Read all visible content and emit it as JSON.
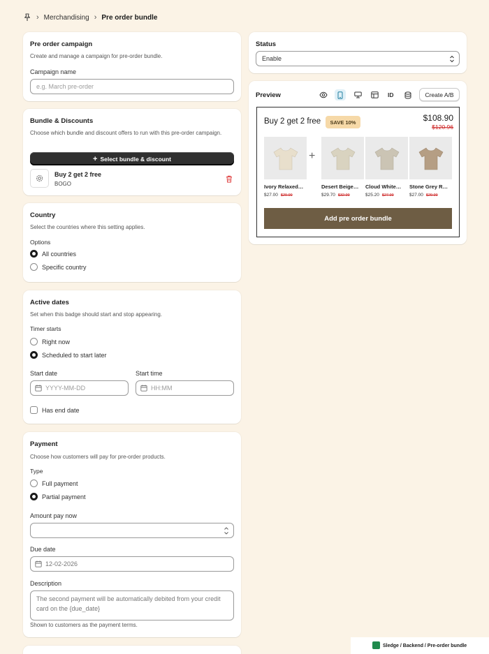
{
  "breadcrumb": {
    "parent": "Merchandising",
    "current": "Pre order bundle"
  },
  "campaign": {
    "title": "Pre order campaign",
    "description": "Create and manage a campaign for pre-order bundle.",
    "name_label": "Campaign name",
    "name_placeholder": "e.g. March pre-order"
  },
  "bundle": {
    "title": "Bundle & Discounts",
    "description": "Choose which bundle and discount offers to run with this pre-order campaign.",
    "select_button": "Select bundle & discount",
    "item_title": "Buy 2 get 2 free",
    "item_subtitle": "BOGO"
  },
  "country": {
    "title": "Country",
    "description": "Select the countries where this setting applies.",
    "options_label": "Options",
    "options": [
      "All countries",
      "Specific country"
    ],
    "selected": "All countries"
  },
  "dates": {
    "title": "Active dates",
    "description": "Set when this badge should start and stop appearing.",
    "timer_label": "Timer starts",
    "timer_options": [
      "Right now",
      "Scheduled to start later"
    ],
    "selected": "Scheduled to start later",
    "start_date_label": "Start date",
    "start_date_placeholder": "YYYY-MM-DD",
    "start_time_label": "Start time",
    "start_time_placeholder": "HH:MM",
    "end_date_label": "Has end date"
  },
  "payment": {
    "title": "Payment",
    "description": "Choose how customers will pay for pre-order products.",
    "type_label": "Type",
    "type_options": [
      "Full payment",
      "Partial payment"
    ],
    "selected": "Partial payment",
    "amount_label": "Amount pay now",
    "amount_value": "",
    "due_label": "Due date",
    "due_value": "12-02-2026",
    "description_label": "Description",
    "description_value": "The second payment will be automatically debited from your credit card on the {due_date}",
    "description_hint": "Shown to customers as the payment terms."
  },
  "status": {
    "title": "Status",
    "value": "Enable"
  },
  "preview": {
    "title": "Preview",
    "id_label": "ID",
    "create_ab": "Create A/B",
    "bundle_title": "Buy 2 get 2 free",
    "save_badge": "SAVE 10%",
    "price_now": "$108.90",
    "price_was": "$120.96",
    "products": [
      {
        "name": "Ivory Relaxed…",
        "price": "$27.00",
        "was": "$29.99",
        "color": "#e8dfcc"
      },
      {
        "name": "Desert Beige…",
        "price": "$29.70",
        "was": "$32.99",
        "color": "#d9d3c0"
      },
      {
        "name": "Cloud White…",
        "price": "$25.20",
        "was": "$27.99",
        "color": "#cbc4b4"
      },
      {
        "name": "Stone Grey R…",
        "price": "$27.00",
        "was": "$29.99",
        "color": "#b59e84"
      }
    ],
    "add_button": "Add pre order bundle"
  },
  "footer": {
    "text": "Sledge / Backend / Pre-order bundle"
  },
  "colors": {
    "background": "#fbf3e6",
    "primary_button": "#303030",
    "add_button": "#6e5d44",
    "save_badge": "#f6d9a8",
    "strike_price": "#cc2222",
    "delete_icon": "#d33333"
  }
}
